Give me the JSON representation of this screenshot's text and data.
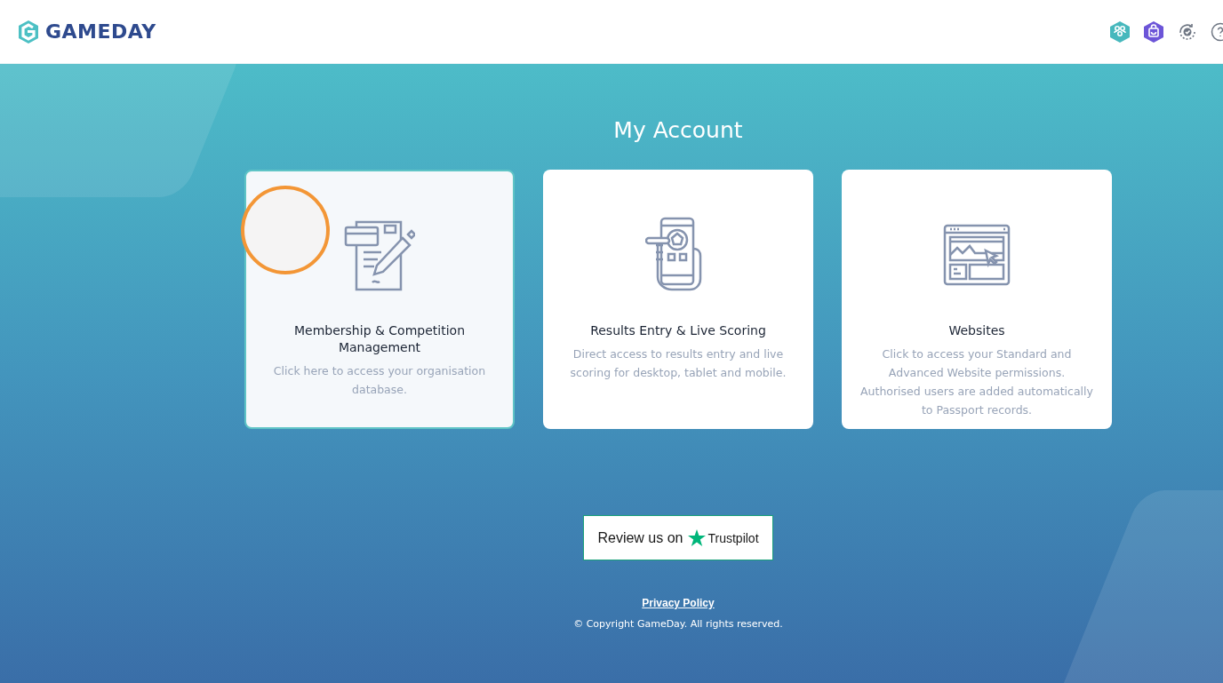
{
  "header": {
    "logo": "GAMEDAY"
  },
  "page_title": "My Account",
  "cards": [
    {
      "title": "Membership & Competition Management",
      "description": "Click here to access your organisation database.",
      "selected": true
    },
    {
      "title": "Results Entry & Live Scoring",
      "description": "Direct access to results entry and live scoring for desktop, tablet and mobile.",
      "selected": false
    },
    {
      "title": "Websites",
      "description": "Click to access your Standard and Advanced Website permissions. Authorised users are added automatically to Passport records.",
      "selected": false
    }
  ],
  "review": {
    "text": "Review us on",
    "brand": "Trustpilot"
  },
  "footer": {
    "link": "Privacy Policy",
    "copyright": "© Copyright GameDay. All rights reserved."
  }
}
